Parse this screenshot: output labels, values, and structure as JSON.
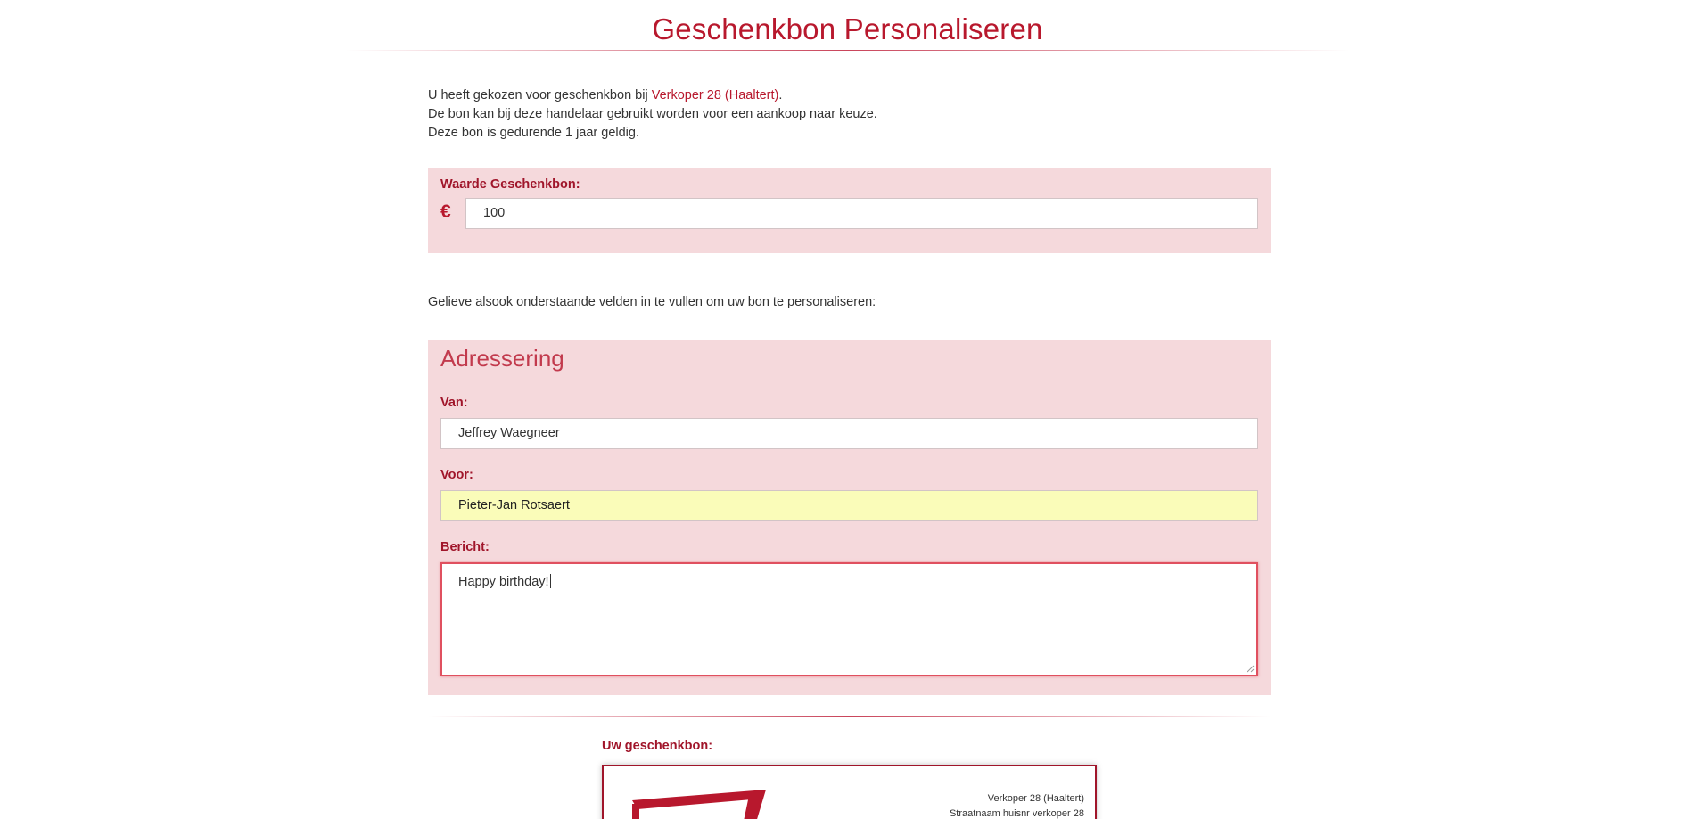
{
  "page": {
    "title": "Geschenkbon Personaliseren"
  },
  "intro": {
    "line1_prefix": "U heeft gekozen voor geschenkbon bij ",
    "seller_link": "Verkoper 28 (Haaltert)",
    "line1_suffix": ".",
    "line2": "De bon kan bij deze handelaar gebruikt worden voor een aankoop naar keuze.",
    "line3": "Deze bon is gedurende 1 jaar geldig."
  },
  "value_panel": {
    "label": "Waarde Geschenkbon:",
    "currency_symbol": "€",
    "amount": "100"
  },
  "helper_text": "Gelieve alsook onderstaande velden in te vullen om uw bon te personaliseren:",
  "address_panel": {
    "heading": "Adressering",
    "from_label": "Van:",
    "from_value": "Jeffrey Waegneer",
    "to_label": "Voor:",
    "to_value": "Pieter-Jan Rotsaert",
    "message_label": "Bericht:",
    "message_value": "Happy birthday!"
  },
  "voucher_preview": {
    "label": "Uw geschenkbon:",
    "seller_name": "Verkoper 28 (Haaltert)",
    "seller_street": "Straatnaam huisnr verkoper 28"
  },
  "colors": {
    "accent": "#b8182d",
    "label": "#a0152a",
    "panel_bg": "#f5d9dc",
    "autofill_bg": "#fafcb9",
    "focus_border": "#e0505f"
  }
}
